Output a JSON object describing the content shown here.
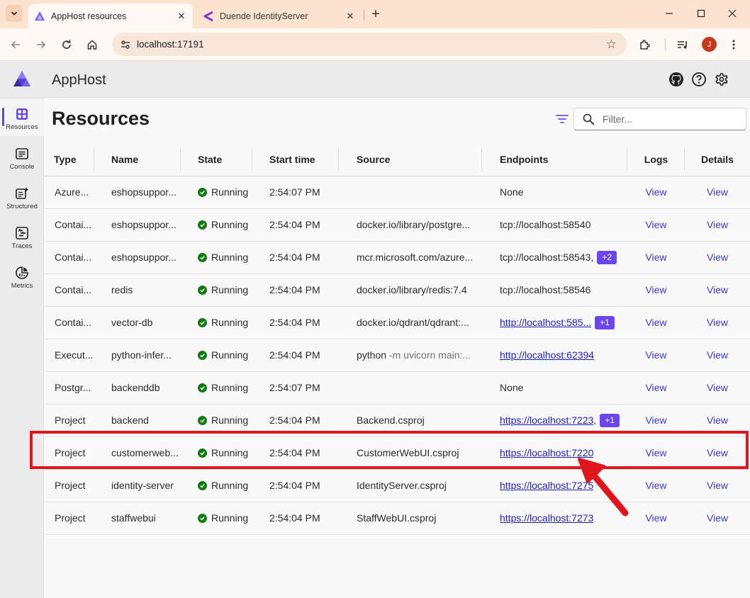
{
  "browser": {
    "tabs": [
      {
        "title": "AppHost resources",
        "active": true
      },
      {
        "title": "Duende IdentityServer",
        "active": false
      }
    ],
    "address": "localhost:17191",
    "profile_initial": "J"
  },
  "app": {
    "title": "AppHost",
    "page_title": "Resources",
    "filter_placeholder": "Filter...",
    "nav": [
      {
        "label": "Resources",
        "icon": "resources-icon",
        "active": true
      },
      {
        "label": "Console",
        "icon": "console-icon"
      },
      {
        "label": "Structured",
        "icon": "structured-logs-icon"
      },
      {
        "label": "Traces",
        "icon": "traces-icon"
      },
      {
        "label": "Metrics",
        "icon": "metrics-icon"
      }
    ],
    "columns": [
      "Type",
      "Name",
      "State",
      "Start time",
      "Source",
      "Endpoints",
      "Logs",
      "Details"
    ],
    "rows": [
      {
        "type": "Azure...",
        "name": "eshopsuppor...",
        "state": "Running",
        "start": "2:54:07 PM",
        "source": "",
        "source_args": "",
        "endpoint": "None",
        "endpoint_link": false,
        "badge": "",
        "logs": "View",
        "details": "View"
      },
      {
        "type": "Contai...",
        "name": "eshopsuppor...",
        "state": "Running",
        "start": "2:54:04 PM",
        "source": "docker.io/library/postgre...",
        "source_args": "",
        "endpoint": "tcp://localhost:58540",
        "endpoint_link": false,
        "badge": "",
        "logs": "View",
        "details": "View"
      },
      {
        "type": "Contai...",
        "name": "eshopsuppor...",
        "state": "Running",
        "start": "2:54:04 PM",
        "source": "mcr.microsoft.com/azure...",
        "source_args": "",
        "endpoint": "tcp://localhost:58543,",
        "endpoint_link": false,
        "badge": "+2",
        "logs": "View",
        "details": "View"
      },
      {
        "type": "Contai...",
        "name": "redis",
        "state": "Running",
        "start": "2:54:04 PM",
        "source": "docker.io/library/redis:7.4",
        "source_args": "",
        "endpoint": "tcp://localhost:58546",
        "endpoint_link": false,
        "badge": "",
        "logs": "View",
        "details": "View"
      },
      {
        "type": "Contai...",
        "name": "vector-db",
        "state": "Running",
        "start": "2:54:04 PM",
        "source": "docker.io/qdrant/qdrant:...",
        "source_args": "",
        "endpoint": "http://localhost:585...",
        "endpoint_link": true,
        "badge": "+1",
        "logs": "View",
        "details": "View"
      },
      {
        "type": "Execut...",
        "name": "python-infer...",
        "state": "Running",
        "start": "2:54:04 PM",
        "source": "python",
        "source_args": "-m uvicorn main:...",
        "endpoint": "http://localhost:62394",
        "endpoint_link": true,
        "badge": "",
        "logs": "View",
        "details": "View"
      },
      {
        "type": "Postgr...",
        "name": "backenddb",
        "state": "Running",
        "start": "2:54:07 PM",
        "source": "",
        "source_args": "",
        "endpoint": "None",
        "endpoint_link": false,
        "badge": "",
        "logs": "View",
        "details": "View"
      },
      {
        "type": "Project",
        "name": "backend",
        "state": "Running",
        "start": "2:54:04 PM",
        "source": "Backend.csproj",
        "source_args": "",
        "endpoint": "https://localhost:7223,",
        "endpoint_link": true,
        "badge": "+1",
        "logs": "View",
        "details": "View"
      },
      {
        "type": "Project",
        "name": "customerweb...",
        "state": "Running",
        "start": "2:54:04 PM",
        "source": "CustomerWebUI.csproj",
        "source_args": "",
        "endpoint": "https://localhost:7220",
        "endpoint_link": true,
        "badge": "",
        "logs": "View",
        "details": "View"
      },
      {
        "type": "Project",
        "name": "identity-server",
        "state": "Running",
        "start": "2:54:04 PM",
        "source": "IdentityServer.csproj",
        "source_args": "",
        "endpoint": "https://localhost:7275",
        "endpoint_link": true,
        "badge": "",
        "logs": "View",
        "details": "View"
      },
      {
        "type": "Project",
        "name": "staffwebui",
        "state": "Running",
        "start": "2:54:04 PM",
        "source": "StaffWebUI.csproj",
        "source_args": "",
        "endpoint": "https://localhost:7273",
        "endpoint_link": true,
        "badge": "",
        "logs": "View",
        "details": "View"
      }
    ]
  },
  "colors": {
    "accent": "#6b46ee",
    "running": "#107c10",
    "annotation": "#e0151d",
    "link": "#1f1fb8"
  }
}
